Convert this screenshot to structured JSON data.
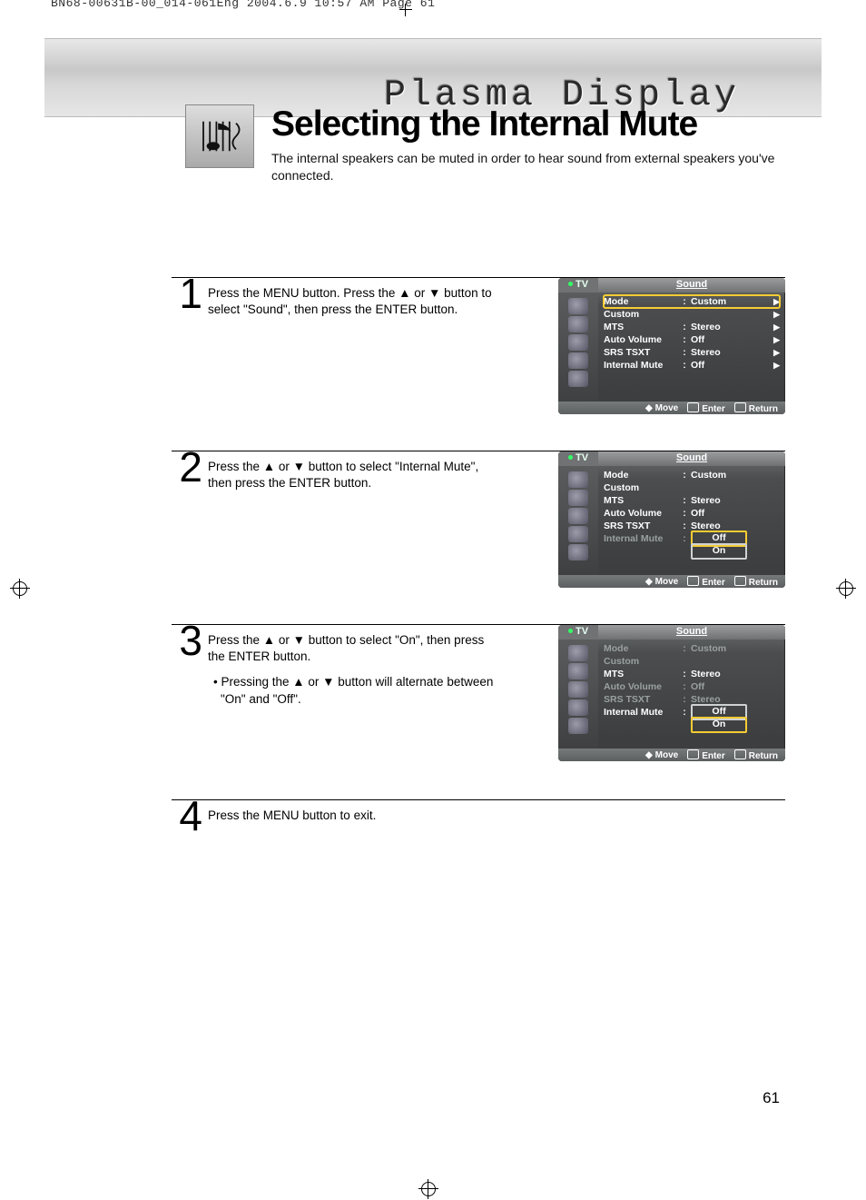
{
  "print_header": "BN68-00631B-00_014-061Eng  2004.6.9  10:57 AM  Page 61",
  "banner_title": "Plasma Display",
  "title": "Selecting the Internal Mute",
  "intro": "The internal speakers can be muted in order to hear sound from external speakers you've connected.",
  "page_number": "61",
  "steps": [
    {
      "num": "1",
      "text": "Press the MENU button. Press the ▲ or ▼ button to select \"Sound\", then press the ENTER button."
    },
    {
      "num": "2",
      "text": "Press the ▲ or ▼ button to select \"Internal Mute\", then press the ENTER button."
    },
    {
      "num": "3",
      "text": "Press the ▲ or ▼ button to select \"On\", then press the ENTER button.",
      "bullet": "• Pressing the ▲ or ▼ button will alternate between \"On\" and \"Off\"."
    },
    {
      "num": "4",
      "text": "Press the MENU button to exit."
    }
  ],
  "osd": {
    "tv_label": "TV",
    "sound_label": "Sound",
    "rows": {
      "mode": {
        "label": "Mode",
        "value": "Custom"
      },
      "custom": {
        "label": "Custom",
        "value": ""
      },
      "mts": {
        "label": "MTS",
        "value": "Stereo"
      },
      "autovol": {
        "label": "Auto Volume",
        "value": "Off"
      },
      "srs": {
        "label": "SRS TSXT",
        "value": "Stereo"
      },
      "intmute": {
        "label": "Internal Mute",
        "value": "Off"
      }
    },
    "options": {
      "off": "Off",
      "on": "On"
    },
    "footer": {
      "move": "Move",
      "enter": "Enter",
      "return": "Return"
    }
  }
}
